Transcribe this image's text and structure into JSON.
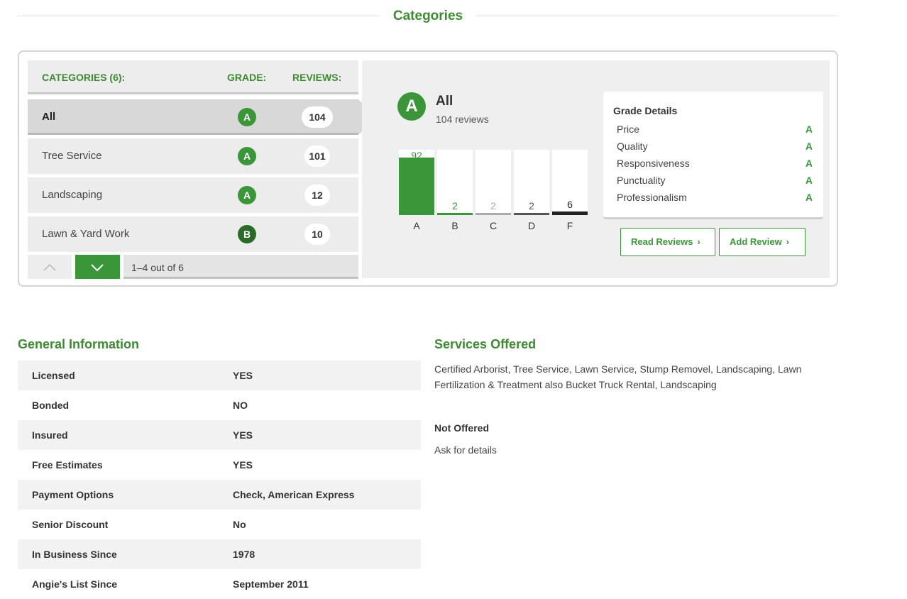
{
  "categories_section": {
    "heading": "Categories",
    "table_headers": {
      "category": "CATEGORIES (6):",
      "grade": "GRADE:",
      "reviews": "REVIEWS:"
    },
    "rows": [
      {
        "name": "All",
        "grade": "A",
        "reviews": "104",
        "selected": true
      },
      {
        "name": "Tree Service",
        "grade": "A",
        "reviews": "101",
        "selected": false
      },
      {
        "name": "Landscaping",
        "grade": "A",
        "reviews": "12",
        "selected": false
      },
      {
        "name": "Lawn & Yard Work",
        "grade": "B",
        "reviews": "10",
        "selected": false
      }
    ],
    "pager_label": "1–4 out of 6"
  },
  "selected_category": {
    "grade": "A",
    "name": "All",
    "reviews_text": "104 reviews"
  },
  "chart_data": {
    "type": "bar",
    "categories": [
      "A",
      "B",
      "C",
      "D",
      "F"
    ],
    "values": [
      92,
      2,
      2,
      2,
      6
    ],
    "ylim": [
      0,
      104
    ],
    "bar_colors": [
      "#3a9639",
      "#3a9639",
      "#aaaaaa",
      "#555555",
      "#222222"
    ]
  },
  "grade_details": {
    "title": "Grade Details",
    "items": [
      {
        "label": "Price",
        "grade": "A"
      },
      {
        "label": "Quality",
        "grade": "A"
      },
      {
        "label": "Responsiveness",
        "grade": "A"
      },
      {
        "label": "Punctuality",
        "grade": "A"
      },
      {
        "label": "Professionalism",
        "grade": "A"
      }
    ]
  },
  "actions": {
    "read_reviews": "Read Reviews",
    "add_review": "Add Review"
  },
  "general_information": {
    "title": "General Information",
    "rows": [
      {
        "key": "Licensed",
        "value": "YES"
      },
      {
        "key": "Bonded",
        "value": "NO"
      },
      {
        "key": "Insured",
        "value": "YES"
      },
      {
        "key": "Free Estimates",
        "value": "YES"
      },
      {
        "key": "Payment Options",
        "value": "Check, American Express"
      },
      {
        "key": "Senior Discount",
        "value": "No"
      },
      {
        "key": "In Business Since",
        "value": "1978"
      },
      {
        "key": "Angie's List Since",
        "value": "September 2011"
      }
    ]
  },
  "services_offered": {
    "title": "Services Offered",
    "text": "Certified Arborist, Tree Service, Lawn Service, Stump Removel, Landscaping, Lawn Fertilization & Treatment also Bucket Truck Rental, Landscaping",
    "not_offered_title": "Not Offered",
    "not_offered_text": "Ask for details"
  },
  "colors": {
    "accent": "#3a9639",
    "accent_dark": "#2a6b28",
    "heading": "#3d8a32"
  },
  "icons": {
    "pager_up": "chevron-up-icon",
    "pager_down": "chevron-down-icon",
    "button_chevron": "chevron-right-icon"
  }
}
